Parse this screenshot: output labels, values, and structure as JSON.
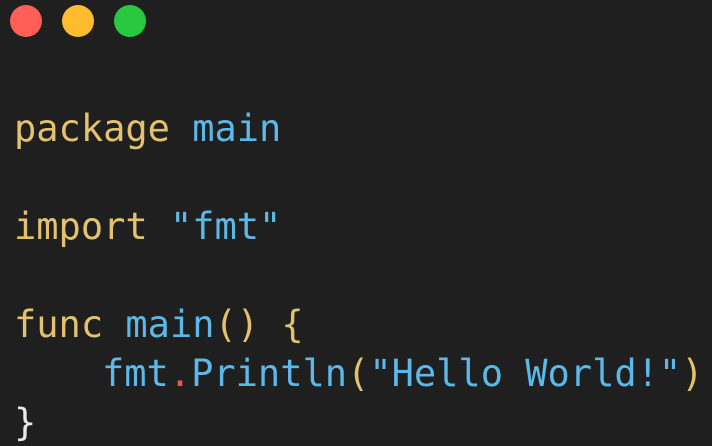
{
  "window": {
    "controls": [
      {
        "name": "close",
        "color": "#ff5f57"
      },
      {
        "name": "minimize",
        "color": "#febc2e"
      },
      {
        "name": "maximize",
        "color": "#28c840"
      }
    ]
  },
  "code": {
    "language": "go",
    "lines": [
      {
        "tokens": [
          {
            "t": "package",
            "c": "kw"
          },
          {
            "t": " ",
            "c": "sp"
          },
          {
            "t": "main",
            "c": "id"
          }
        ]
      },
      {
        "tokens": []
      },
      {
        "tokens": [
          {
            "t": "import",
            "c": "kw"
          },
          {
            "t": " ",
            "c": "sp"
          },
          {
            "t": "\"fmt\"",
            "c": "str"
          }
        ]
      },
      {
        "tokens": []
      },
      {
        "tokens": [
          {
            "t": "func",
            "c": "kw"
          },
          {
            "t": " ",
            "c": "sp"
          },
          {
            "t": "main",
            "c": "id"
          },
          {
            "t": "()",
            "c": "punc"
          },
          {
            "t": " ",
            "c": "sp"
          },
          {
            "t": "{",
            "c": "punc"
          }
        ]
      },
      {
        "indent": true,
        "tokens": [
          {
            "t": "fmt",
            "c": "id"
          },
          {
            "t": ".",
            "c": "dot"
          },
          {
            "t": "Println",
            "c": "fn"
          },
          {
            "t": "(",
            "c": "punc"
          },
          {
            "t": "\"Hello World!\"",
            "c": "str"
          },
          {
            "t": ")",
            "c": "punc"
          }
        ]
      },
      {
        "tokens": [
          {
            "t": "}",
            "c": "br"
          }
        ]
      }
    ]
  }
}
